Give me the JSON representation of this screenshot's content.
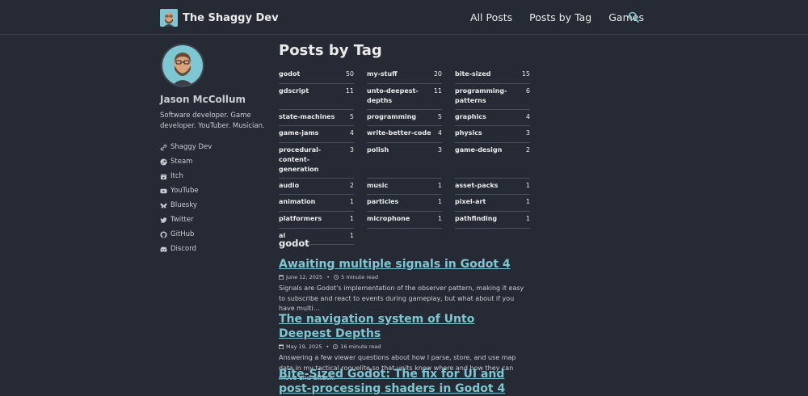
{
  "header": {
    "site_title": "The Shaggy Dev",
    "nav": [
      "All Posts",
      "Posts by Tag",
      "Games"
    ]
  },
  "sidebar": {
    "name": "Jason McCollum",
    "bio": "Software developer. Game developer. YouTuber. Musician.",
    "links": [
      {
        "label": "Shaggy Dev",
        "icon": "link-icon"
      },
      {
        "label": "Steam",
        "icon": "steam-icon"
      },
      {
        "label": "Itch",
        "icon": "itch-icon"
      },
      {
        "label": "YouTube",
        "icon": "youtube-icon"
      },
      {
        "label": "Bluesky",
        "icon": "bluesky-icon"
      },
      {
        "label": "Twitter",
        "icon": "twitter-icon"
      },
      {
        "label": "GitHub",
        "icon": "github-icon"
      },
      {
        "label": "Discord",
        "icon": "discord-icon"
      }
    ]
  },
  "main": {
    "title": "Posts by Tag",
    "tags": [
      {
        "name": "godot",
        "count": "50"
      },
      {
        "name": "my-stuff",
        "count": "20"
      },
      {
        "name": "bite-sized",
        "count": "15"
      },
      {
        "name": "gdscript",
        "count": "11"
      },
      {
        "name": "unto-deepest-depths",
        "count": "11"
      },
      {
        "name": "programming-patterns",
        "count": "6"
      },
      {
        "name": "state-machines",
        "count": "5"
      },
      {
        "name": "programming",
        "count": "5"
      },
      {
        "name": "graphics",
        "count": "4"
      },
      {
        "name": "game-jams",
        "count": "4"
      },
      {
        "name": "write-better-code",
        "count": "4"
      },
      {
        "name": "physics",
        "count": "3"
      },
      {
        "name": "procedural-content-generation",
        "count": "3"
      },
      {
        "name": "polish",
        "count": "3"
      },
      {
        "name": "game-design",
        "count": "2"
      },
      {
        "name": "audio",
        "count": "2"
      },
      {
        "name": "music",
        "count": "1"
      },
      {
        "name": "asset-packs",
        "count": "1"
      },
      {
        "name": "animation",
        "count": "1"
      },
      {
        "name": "particles",
        "count": "1"
      },
      {
        "name": "pixel-art",
        "count": "1"
      },
      {
        "name": "platformers",
        "count": "1"
      },
      {
        "name": "microphone",
        "count": "1"
      },
      {
        "name": "pathfinding",
        "count": "1"
      },
      {
        "name": "ai",
        "count": "1"
      }
    ],
    "section": "godot",
    "posts": [
      {
        "title": "Awaiting multiple signals in Godot 4",
        "date": "June 12, 2025",
        "read": "5 minute read",
        "excerpt": "Signals are Godot’s implementation of the observer pattern, making it easy to subscribe and react to events during gameplay, but what about if you have multi…"
      },
      {
        "title": "The navigation system of Unto Deepest Depths",
        "date": "May 19, 2025",
        "read": "16 minute read",
        "excerpt": "Answering a few viewer questions about how I parse, store, and use map data in my tactical roguelite so that units know where and how they can move and attack."
      },
      {
        "title": "Bite-Sized Godot: The fix for UI and post-processing shaders in Godot 4"
      }
    ]
  },
  "colors": {
    "background": "#252a34",
    "accent": "#7fc6d3",
    "text": "#eaeaea",
    "muted": "#c9cdd3"
  }
}
